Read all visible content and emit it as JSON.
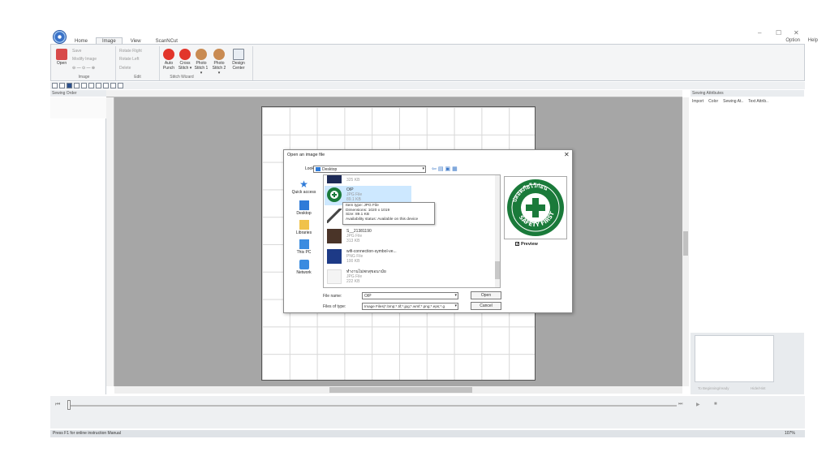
{
  "window": {
    "minimize": "–",
    "maximize": "☐",
    "close": "✕"
  },
  "menu": {
    "tabs": [
      "Home",
      "Image",
      "View",
      "ScanNCut"
    ],
    "active_tab": "Image",
    "option": "Option",
    "help": "Help"
  },
  "ribbon": {
    "image_group": {
      "label": "Image",
      "open": "Open",
      "save": "Save",
      "modify_image": "Modify Image"
    },
    "edit_group": {
      "label": "Edit",
      "rotate_right": "Rotate Right",
      "rotate_left": "Rotate Left",
      "delete": "Delete"
    },
    "stitch_group": {
      "label": "Stitch Wizard",
      "auto_punch": "Auto\nPunch",
      "cross_stitch": "Cross\nStitch ▾",
      "photo_stitch1": "Photo\nStitch 1 ▾",
      "photo_stitch2": "Photo\nStitch 2 ▾",
      "design_center": "Design\nCenter"
    }
  },
  "left_panel": {
    "title": "Sewing Order"
  },
  "right_panel": {
    "title": "Sewing Attributes",
    "tabs": [
      "Import",
      "Color",
      "Sewing At..",
      "Text Attrib.."
    ],
    "bottom_buttons": [
      "To Beginning/ready",
      "Hide/Hint"
    ]
  },
  "status": {
    "text": "Press F1 for online instruction Manual",
    "zoom": "107%"
  },
  "dialog": {
    "title": "Open an image file",
    "look_in_label": "Look in:",
    "look_in_value": "Desktop",
    "places": [
      "Quick access",
      "Desktop",
      "Libraries",
      "This PC",
      "Network"
    ],
    "files": [
      {
        "name": "",
        "type": "",
        "size": "325 KB"
      },
      {
        "name": "OIP",
        "type": "JPG File",
        "size": "89.1 KB"
      },
      {
        "name": "",
        "type": "",
        "size": ""
      },
      {
        "name": "S__21381190",
        "type": "JPG File",
        "size": "313 KB"
      },
      {
        "name": "wifi-connection-symbol-ve...",
        "type": "PNG File",
        "size": "100 KB"
      },
      {
        "name": "ทำงานไม่พกสุขอนามัย",
        "type": "JPG File",
        "size": "222 KB"
      }
    ],
    "tooltip": {
      "line1": "Item type: JPG File",
      "line2": "Dimensions: 1020 x 1019",
      "line3": "Size: 89.1 KB",
      "line4": "Availability status: Available on this device"
    },
    "preview_label": "Preview",
    "file_name_label": "File name:",
    "file_name_value": "OIP",
    "file_type_label": "Files of type:",
    "file_type_value": "Image Files(*.bmp;*.tif;*.jpg;*.wmf;*.png;*.eps;*.g",
    "open_button": "Open",
    "cancel_button": "Cancel",
    "logo_text_top": "ปลอดภัยไว้ก่อน",
    "logo_text_bottom": "SAFETY FIRST"
  }
}
